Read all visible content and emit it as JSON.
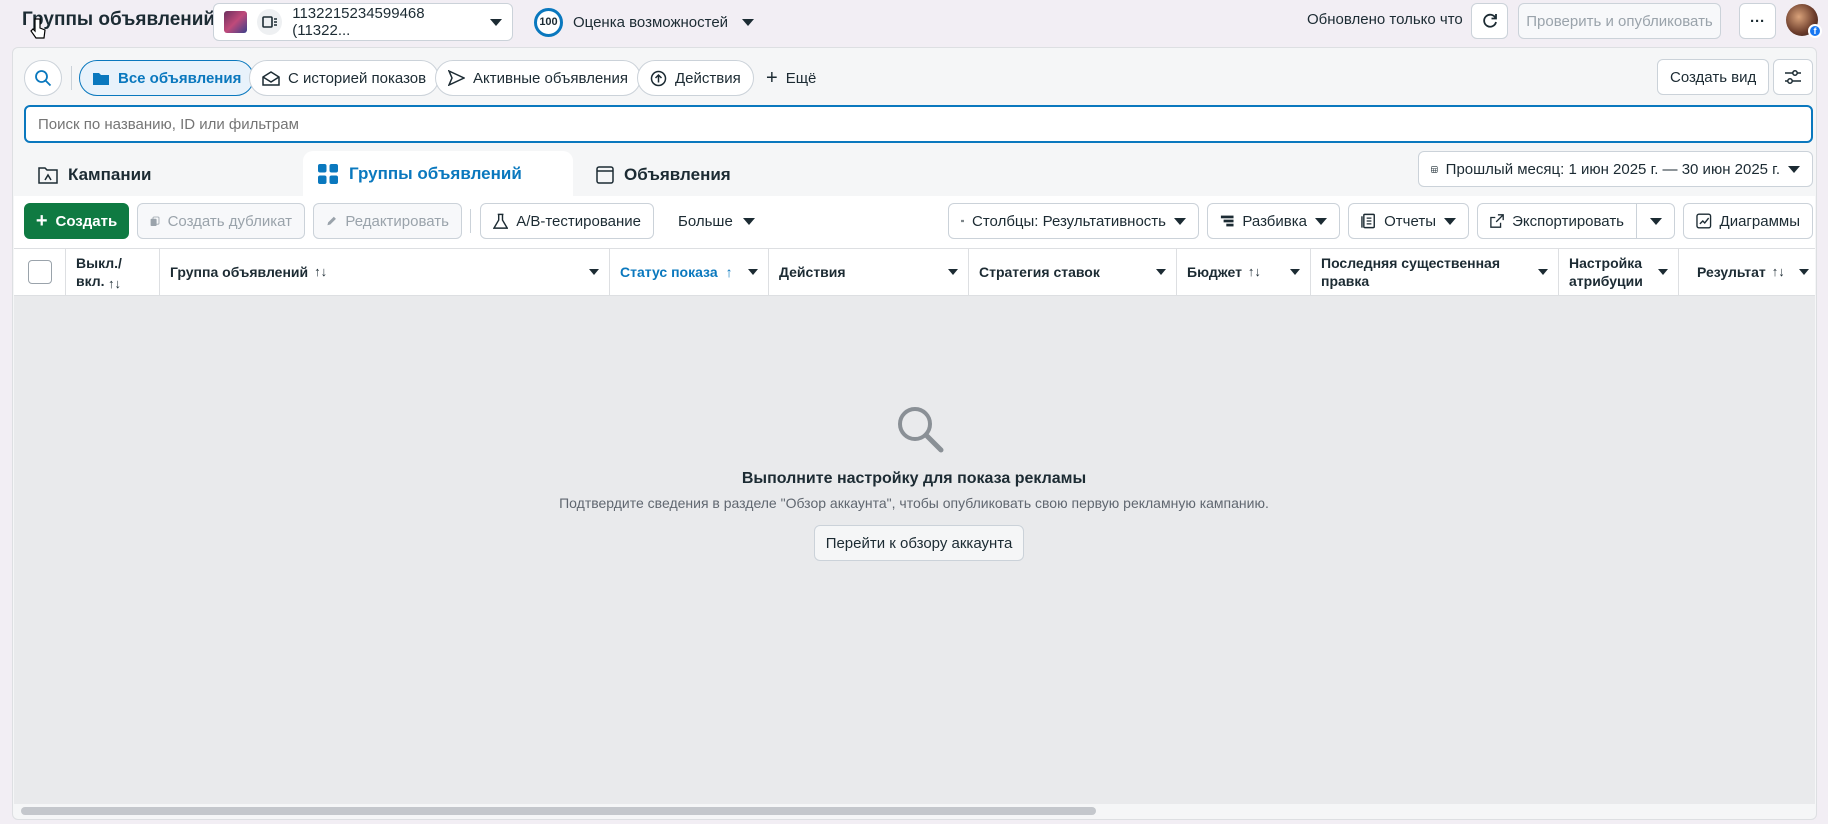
{
  "header": {
    "title": "Группы объявлений",
    "account_label": "1132215234599468 (11322...",
    "score_value": "100",
    "score_label": "Оценка возможностей",
    "updated_text": "Обновлено только что",
    "publish_label": "Проверить и опубликовать",
    "more_label": "···"
  },
  "filters": {
    "all_ads": "Все объявления",
    "with_history": "С историей показов",
    "active_ads": "Активные объявления",
    "actions": "Действия",
    "more": "Ещё",
    "create_view": "Создать вид"
  },
  "search": {
    "placeholder": "Поиск по названию, ID или фильтрам"
  },
  "tabs": {
    "campaigns": "Кампании",
    "adsets": "Группы объявлений",
    "ads": "Объявления"
  },
  "date_range": "Прошлый месяц: 1 июн 2025 г. — 30 июн 2025 г.",
  "toolbar": {
    "create": "Создать",
    "duplicate": "Создать дубликат",
    "edit": "Редактировать",
    "ab_test": "A/B-тестирование",
    "more": "Больше",
    "columns": "Столбцы: Результативность",
    "breakdown": "Разбивка",
    "reports": "Отчеты",
    "export": "Экспортировать",
    "charts": "Диаграммы"
  },
  "columns": [
    {
      "label": "Выкл./ вкл.",
      "sort": "↑↓"
    },
    {
      "label": "Группа объявлений",
      "sort": "↑↓"
    },
    {
      "label": "Статус показа",
      "sort": "↑"
    },
    {
      "label": "Действия"
    },
    {
      "label": "Стратегия ставок"
    },
    {
      "label": "Бюджет",
      "sort": "↑↓"
    },
    {
      "label": "Последняя существенная правка"
    },
    {
      "label": "Настройка атрибуции"
    },
    {
      "label": "Результат",
      "sort": "↑↓"
    }
  ],
  "empty_state": {
    "title": "Выполните настройку для показа рекламы",
    "subtitle": "Подтвердите сведения в разделе \"Обзор аккаунта\", чтобы опубликовать свою первую рекламную кампанию.",
    "button": "Перейти к обзору аккаунта"
  },
  "colors": {
    "accent": "#0a78be",
    "green": "#0f7a42",
    "border": "#cbd2d9"
  }
}
